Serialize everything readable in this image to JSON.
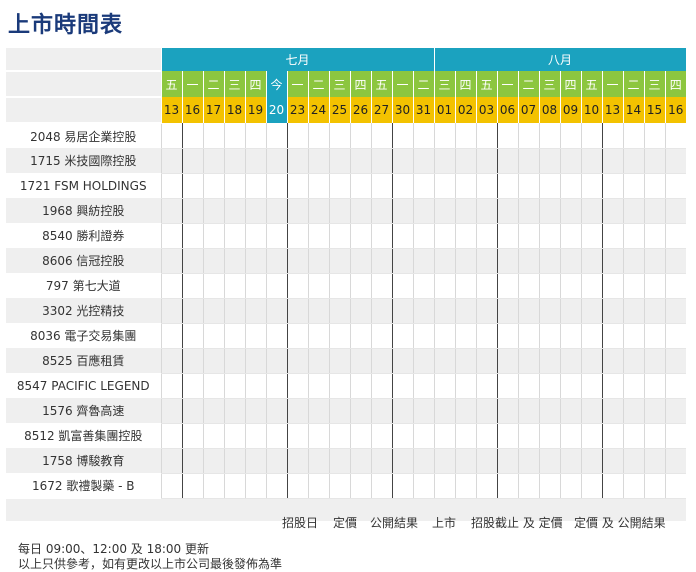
{
  "title": "上市時間表",
  "months": [
    {
      "label": "七月",
      "span": 13
    },
    {
      "label": "八月",
      "span": 12
    }
  ],
  "days": [
    {
      "w": "五",
      "d": "13"
    },
    {
      "w": "一",
      "d": "16"
    },
    {
      "w": "二",
      "d": "17"
    },
    {
      "w": "三",
      "d": "18"
    },
    {
      "w": "四",
      "d": "19"
    },
    {
      "w": "今",
      "d": "20",
      "today": true
    },
    {
      "w": "一",
      "d": "23"
    },
    {
      "w": "二",
      "d": "24"
    },
    {
      "w": "三",
      "d": "25"
    },
    {
      "w": "四",
      "d": "26"
    },
    {
      "w": "五",
      "d": "27"
    },
    {
      "w": "一",
      "d": "30"
    },
    {
      "w": "二",
      "d": "31"
    },
    {
      "w": "三",
      "d": "01"
    },
    {
      "w": "四",
      "d": "02"
    },
    {
      "w": "五",
      "d": "03"
    },
    {
      "w": "一",
      "d": "06"
    },
    {
      "w": "二",
      "d": "07"
    },
    {
      "w": "三",
      "d": "08"
    },
    {
      "w": "四",
      "d": "09"
    },
    {
      "w": "五",
      "d": "10"
    },
    {
      "w": "一",
      "d": "13"
    },
    {
      "w": "二",
      "d": "14"
    },
    {
      "w": "三",
      "d": "15"
    },
    {
      "w": "四",
      "d": "16"
    }
  ],
  "companies": [
    "2048 易居企業控股",
    "1715 米技國際控股",
    "1721 FSM HOLDINGS",
    "1968 興紡控股",
    "8540 勝利證券",
    "8606 信冠控股",
    "797 第七大道",
    "3302 光控精技",
    "8036 電子交易集團",
    "8525 百應租賃",
    "8547 PACIFIC LEGEND",
    "1576 齊魯高速",
    "8512 凱富善集團控股",
    "1758 博駿教育",
    "1672 歌禮製藥 - B"
  ],
  "legend": [
    "招股日",
    "定價",
    "公開結果",
    "上市",
    "招股截止 及 定價",
    "定價 及 公開結果"
  ],
  "footer": {
    "line1": "每日 09:00、12:00 及 18:00 更新",
    "line2": "以上只供參考，如有更改以上市公司最後發佈為準"
  }
}
